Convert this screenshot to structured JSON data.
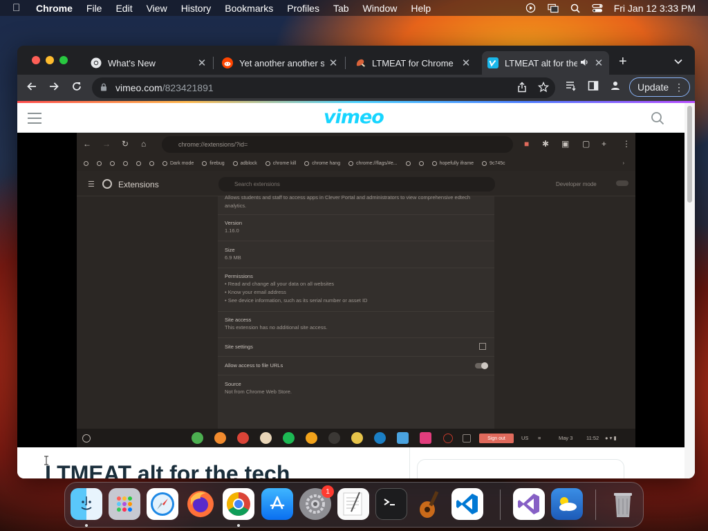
{
  "menubar": {
    "app_name": "Chrome",
    "items": [
      "File",
      "Edit",
      "View",
      "History",
      "Bookmarks",
      "Profiles",
      "Tab",
      "Window",
      "Help"
    ],
    "clock": "Fri Jan 12  3:33 PM"
  },
  "browser": {
    "tabs": [
      {
        "title": "What's New",
        "favicon": "chrome-icon"
      },
      {
        "title": "Yet another another si",
        "favicon": "reddit-icon"
      },
      {
        "title": "LTMEAT for Chrome",
        "favicon": "ltmeat-icon"
      },
      {
        "title": "LTMEAT alt for the",
        "favicon": "vimeo-icon",
        "active": true
      }
    ],
    "url_host": "vimeo.com",
    "url_path": "/823421891",
    "update_label": "Update"
  },
  "vimeo": {
    "logo": "vimeo",
    "page_title": "LTMEAT alt for the tech"
  },
  "video": {
    "inner_url": "chrome://extensions/?id=",
    "bookmarks": [
      "Dark mode",
      "firebug",
      "adblock",
      "chrome kill",
      "chrome hang",
      "chrome://flags/#e...",
      "hopefully iframe",
      "9c745c"
    ],
    "extensions_title": "Extensions",
    "search_placeholder": "Search extensions",
    "developer_mode": "Developer mode",
    "description": "Allows students and staff to access apps in Clever Portal and administrators to view comprehensive edtech analytics.",
    "version_label": "Version",
    "version_value": "1.16.0",
    "size_label": "Size",
    "size_value": "6.9 MB",
    "permissions_label": "Permissions",
    "permissions": [
      "Read and change all your data on all websites",
      "Know your email address",
      "See device information, such as its serial number or asset ID"
    ],
    "site_access_label": "Site access",
    "site_access_value": "This extension has no additional site access.",
    "site_settings_label": "Site settings",
    "file_urls_label": "Allow access to file URLs",
    "source_label": "Source",
    "source_value": "Not from Chrome Web Store.",
    "shelf": {
      "sign_out": "Sign out",
      "locale": "US",
      "date": "May 3",
      "time": "11:52"
    }
  },
  "dock": {
    "apps": [
      "Finder",
      "Launchpad",
      "Safari",
      "Firefox",
      "Chrome",
      "App Store",
      "System Settings",
      "TextEdit",
      "Terminal",
      "GarageBand",
      "Visual Studio Code",
      "Visual Studio",
      "Weather",
      "Trash"
    ],
    "settings_badge": "1"
  }
}
